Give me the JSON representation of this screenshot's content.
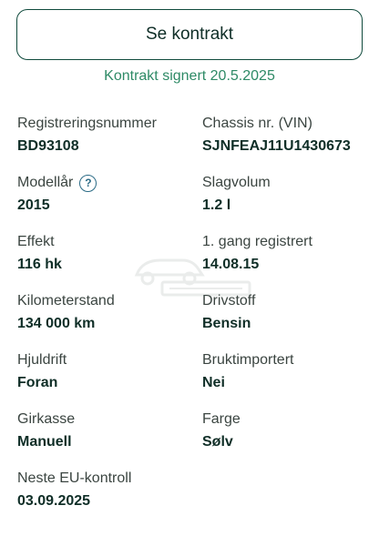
{
  "contract_button": {
    "label": "Se kontrakt"
  },
  "contract_status": {
    "text": "Kontrakt signert 20.5.2025"
  },
  "details": [
    [
      {
        "label": "Registreringsnummer",
        "value": "BD93108"
      },
      {
        "label": "Chassis nr. (VIN)",
        "value": "SJNFEAJ11U1430673"
      }
    ],
    [
      {
        "label": "Modellår",
        "value": "2015",
        "help_icon": "question-circle-icon"
      },
      {
        "label": "Slagvolum",
        "value": "1.2 l"
      }
    ],
    [
      {
        "label": "Effekt",
        "value": "116 hk"
      },
      {
        "label": "1. gang registrert",
        "value": "14.08.15"
      }
    ],
    [
      {
        "label": "Kilometerstand",
        "value": "134 000 km"
      },
      {
        "label": "Drivstoff",
        "value": "Bensin"
      }
    ],
    [
      {
        "label": "Hjuldrift",
        "value": "Foran"
      },
      {
        "label": "Bruktimportert",
        "value": "Nei"
      }
    ],
    [
      {
        "label": "Girkasse",
        "value": "Manuell"
      },
      {
        "label": "Farge",
        "value": "Sølv"
      }
    ],
    [
      {
        "label": "Neste EU-kontroll",
        "value": "03.09.2025"
      }
    ]
  ],
  "help_icon_glyph": "?",
  "colors": {
    "accent_green": "#2e8a66",
    "button_border": "#0f4a3c",
    "help_icon": "#2b6b86",
    "value_text": "#0f2e27"
  }
}
